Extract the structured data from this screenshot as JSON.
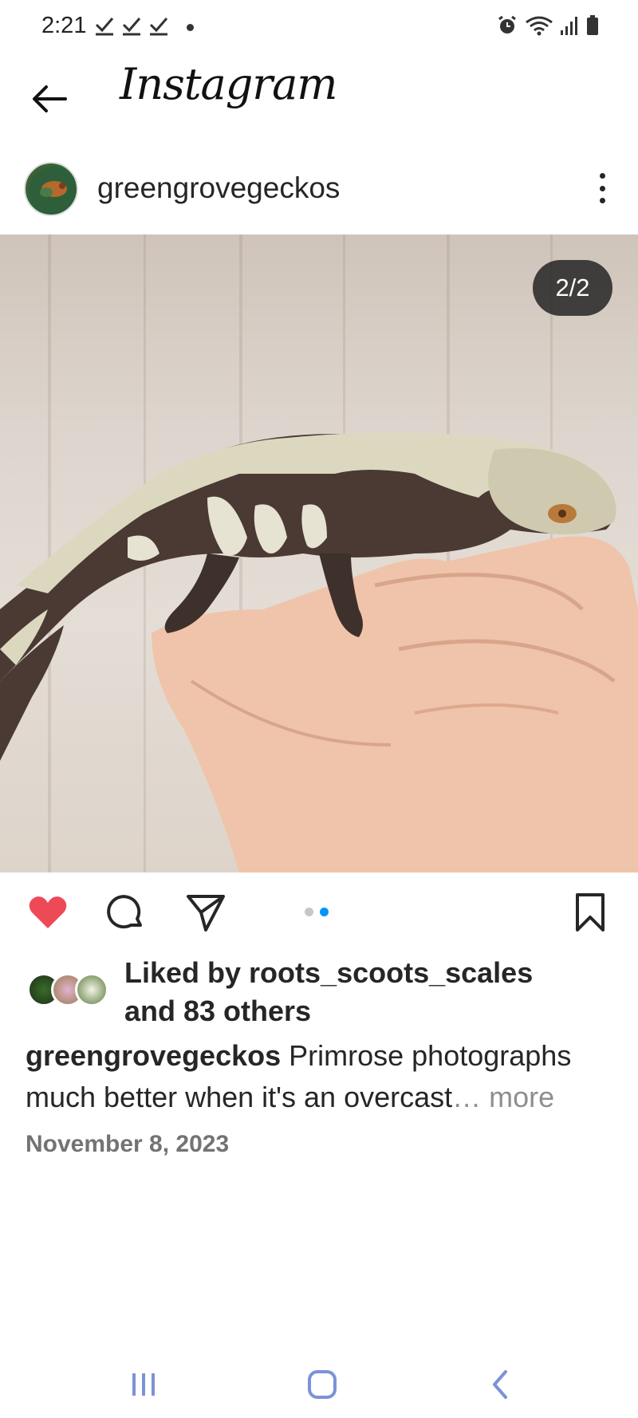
{
  "status_bar": {
    "time": "2:21",
    "icons": [
      "check-icon",
      "check-icon",
      "check-icon",
      "dot-icon",
      "alarm-icon",
      "wifi-icon",
      "signal-icon",
      "battery-icon"
    ]
  },
  "header": {
    "title": "Instagram",
    "back_icon": "back-arrow-icon"
  },
  "post": {
    "username": "greengrovegeckos",
    "more_icon": "more-vertical-icon",
    "photo_counter": "2/2",
    "carousel": {
      "total": 2,
      "active_index": 1
    },
    "actions": [
      "heart-icon",
      "comment-icon",
      "share-icon",
      "bookmark-icon"
    ],
    "liked": true,
    "likes": {
      "line1": "Liked by roots_scoots_scales",
      "line2": "and 83 others"
    },
    "caption": {
      "username": "greengrovegeckos",
      "text_line1": " Primrose photographs",
      "text_line2": "much better when it's an overcast",
      "more": "… more"
    },
    "date": "November 8, 2023"
  },
  "colors": {
    "like_red": "#ed4956",
    "active_dot": "#0095f6",
    "inactive_dot": "#c7c7c7",
    "nav_icon": "#7b93d6"
  }
}
